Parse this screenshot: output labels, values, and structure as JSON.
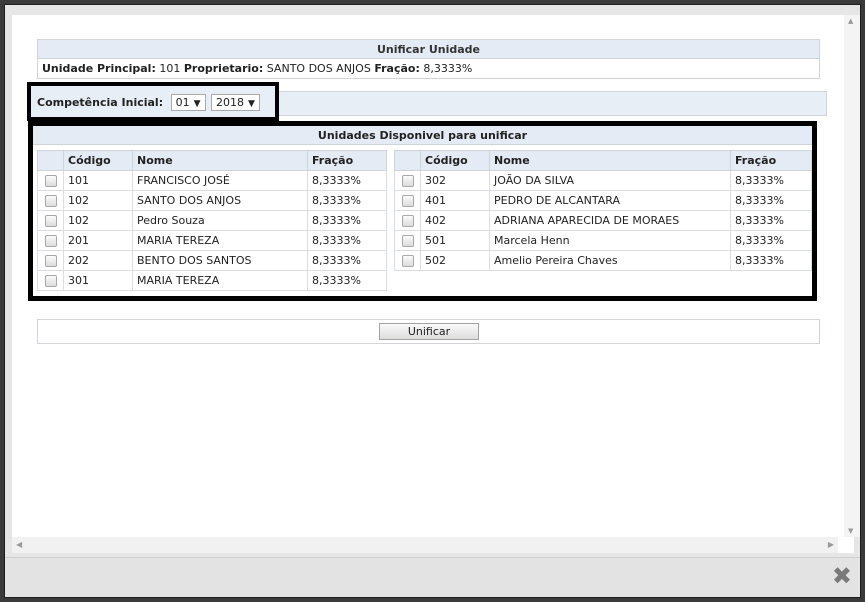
{
  "header": {
    "title": "Unificar Unidade",
    "main_unit_label": "Unidade Principal:",
    "main_unit_value": "101",
    "owner_label": "Proprietario:",
    "owner_value": "SANTO DOS ANJOS",
    "fraction_label": "Fração:",
    "fraction_value": "8,3333%"
  },
  "competencia": {
    "label": "Competência Inicial:",
    "month": "01",
    "year": "2018"
  },
  "units": {
    "title": "Unidades Disponivel para unificar",
    "columns": {
      "codigo": "Código",
      "nome": "Nome",
      "fracao": "Fração"
    },
    "left_rows": [
      {
        "codigo": "101",
        "nome": "FRANCISCO JOSÉ",
        "fracao": "8,3333%"
      },
      {
        "codigo": "102",
        "nome": "SANTO DOS ANJOS",
        "fracao": "8,3333%"
      },
      {
        "codigo": "102",
        "nome": "Pedro Souza",
        "fracao": "8,3333%"
      },
      {
        "codigo": "201",
        "nome": "MARIA TEREZA",
        "fracao": "8,3333%"
      },
      {
        "codigo": "202",
        "nome": "BENTO DOS SANTOS",
        "fracao": "8,3333%"
      },
      {
        "codigo": "301",
        "nome": "MARIA TEREZA",
        "fracao": "8,3333%"
      }
    ],
    "right_rows": [
      {
        "codigo": "302",
        "nome": "JOÃO DA SILVA",
        "fracao": "8,3333%"
      },
      {
        "codigo": "401",
        "nome": "PEDRO DE ALCANTARA",
        "fracao": "8,3333%"
      },
      {
        "codigo": "402",
        "nome": "ADRIANA APARECIDA DE MORAES",
        "fracao": "8,3333%"
      },
      {
        "codigo": "501",
        "nome": "Marcela Henn",
        "fracao": "8,3333%"
      },
      {
        "codigo": "502",
        "nome": "Amelio Pereira Chaves",
        "fracao": "8,3333%"
      }
    ]
  },
  "actions": {
    "unify_label": "Unificar"
  },
  "icons": {
    "close": "close-icon",
    "caret": "caret-down-icon",
    "scroll_up": "scroll-up-icon",
    "scroll_down": "scroll-down-icon",
    "scroll_left": "scroll-left-icon",
    "scroll_right": "scroll-right-icon"
  },
  "colors": {
    "panel_header": "#e4ebf5",
    "border": "#cfd4d9",
    "highlight_border": "#000000"
  }
}
